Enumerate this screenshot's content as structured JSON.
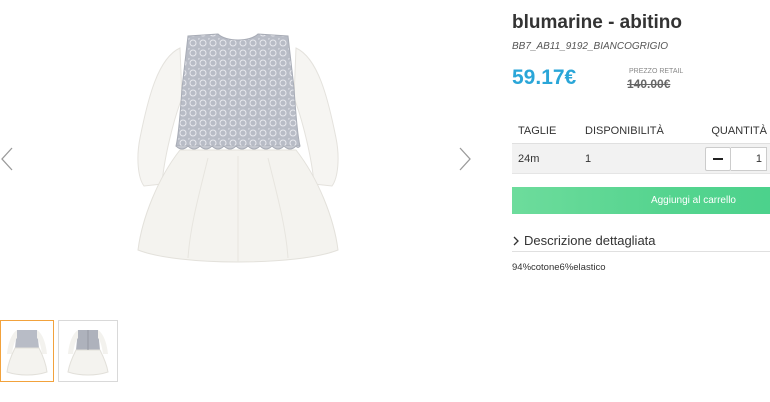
{
  "product": {
    "title": "blumarine - abitino",
    "sku": "BB7_AB11_9192_BIANCOGRIGIO",
    "price": "59.17€",
    "retail_label": "PREZZO RETAIL",
    "retail_price": "140.00€"
  },
  "table": {
    "headers": {
      "size": "TAGLIE",
      "availability": "DISPONIBILITÀ",
      "quantity": "QUANTITÀ"
    },
    "row": {
      "size": "24m",
      "availability": "1",
      "quantity": "1"
    }
  },
  "actions": {
    "add_to_cart": "Aggiungi al carrello"
  },
  "description": {
    "toggle_label": "Descrizione dettagliata",
    "text": "94%cotone6%elastico"
  },
  "gallery": {
    "prev_icon": "chevron-left-icon",
    "next_icon": "chevron-right-icon",
    "thumbnail_count": 2,
    "active_thumbnail": 1
  },
  "colors": {
    "price": "#2aa6d8",
    "button": "#55d48f",
    "active_thumb_border": "#f2a23c"
  }
}
